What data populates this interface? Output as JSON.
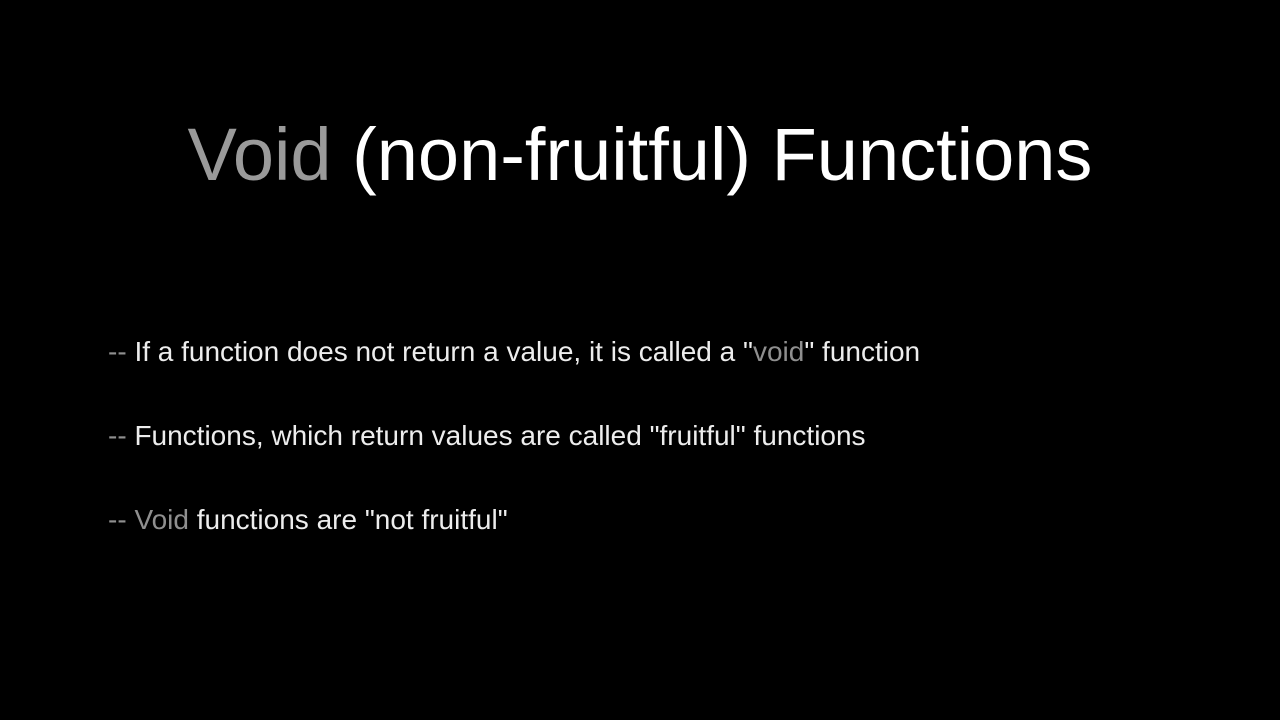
{
  "title": {
    "part1": "Void",
    "part2": " (non-fruitful) Functions"
  },
  "bullets": [
    {
      "prefix": "-- ",
      "t1": "If a function does not return a value, it is called a \"",
      "dim": "void",
      "t2": "\" function"
    },
    {
      "prefix": "-- ",
      "t1": "Functions, which return values are called \"fruitful\" functions",
      "dim": "",
      "t2": ""
    },
    {
      "prefix": "-- ",
      "t1": "",
      "dim": "Void",
      "t2": " functions are \"not fruitful\""
    }
  ]
}
